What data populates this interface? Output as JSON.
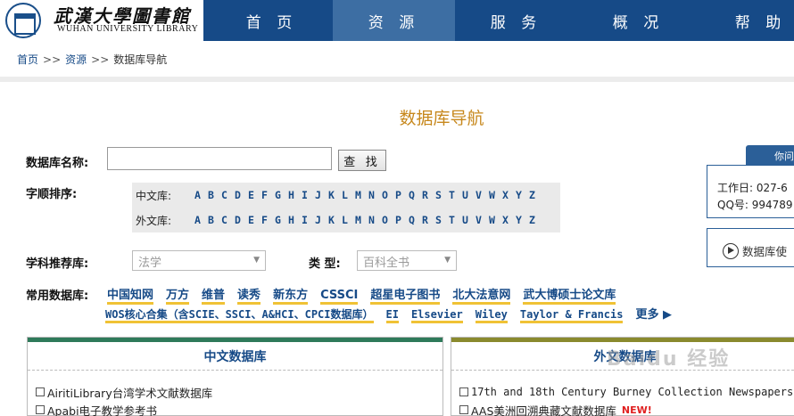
{
  "logo": {
    "cn": "武漢大學圖書館",
    "en": "WUHAN UNIVERSITY LIBRARY"
  },
  "nav": [
    "首 页",
    "资 源",
    "服 务",
    "概 况",
    "帮 助"
  ],
  "breadcrumb": {
    "home": "首页",
    "resources": "资源",
    "current": "数据库导航",
    "sep": ">>"
  },
  "title": "数据库导航",
  "search": {
    "label": "数据库名称:",
    "value": "",
    "button": "查 找"
  },
  "alpha": {
    "label": "字顺排序:",
    "cn_label": "中文库:",
    "en_label": "外文库:",
    "letters": [
      "A",
      "B",
      "C",
      "D",
      "E",
      "F",
      "G",
      "H",
      "I",
      "J",
      "K",
      "L",
      "M",
      "N",
      "O",
      "P",
      "Q",
      "R",
      "S",
      "T",
      "U",
      "V",
      "W",
      "X",
      "Y",
      "Z"
    ]
  },
  "subject": {
    "label": "学科推荐库:",
    "value": "法学"
  },
  "type": {
    "label": "类  型:",
    "value": "百科全书"
  },
  "common": {
    "label": "常用数据库:",
    "row1": [
      "中国知网",
      "万方",
      "维普",
      "读秀",
      "新东方",
      "CSSCI",
      "超星电子图书",
      "北大法意网",
      "武大博硕士论文库"
    ],
    "row2": [
      "WOS核心合集（含SCIE、SSCI、A&HCI、CPCI数据库）",
      "EI",
      "Elsevier",
      "Wiley",
      "Taylor & Francis"
    ],
    "more": "更多"
  },
  "panel_cn": {
    "title": "中文数据库",
    "items": [
      "AiritiLibrary台湾学术文献数据库",
      "Apabi电子教学参考书"
    ]
  },
  "panel_en": {
    "title": "外文数据库",
    "items": [
      "17th and 18th Century Burney Collection Newspapers",
      "AAS美洲回溯典藏文献数据库"
    ],
    "new": "NEW!"
  },
  "side": {
    "tab": "你问",
    "phone": "工作日: 027-6",
    "qq": "QQ号: 994789",
    "guide": "数据库使"
  },
  "colors": {
    "nav_bg": "#164a87",
    "nav_active": "#3d6ea3",
    "title": "#c7881d",
    "link": "#164a87",
    "underline": "#f0c235"
  },
  "watermark": "Baidu 经验"
}
